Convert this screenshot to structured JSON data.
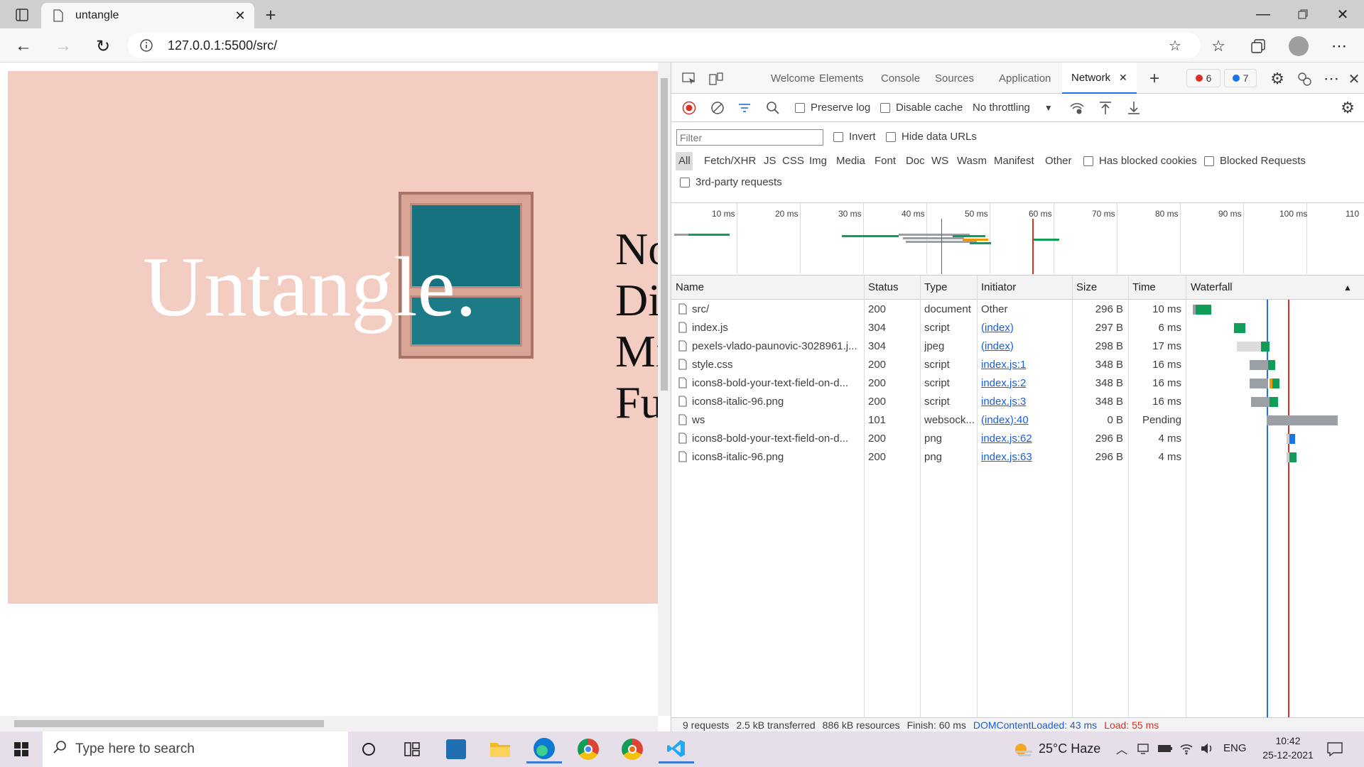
{
  "browser": {
    "tab_title": "untangle",
    "url": "127.0.0.1:5500/src/"
  },
  "page": {
    "hero_title": "Untangle.",
    "side_words": [
      "No",
      "Dis",
      "Mi",
      "Fu"
    ]
  },
  "devtools": {
    "tabs": [
      "Welcome",
      "Elements",
      "Console",
      "Sources",
      "Application",
      "Network"
    ],
    "active_tab": "Network",
    "error_count": "6",
    "message_count": "7",
    "toolbar": {
      "preserve_log": "Preserve log",
      "disable_cache": "Disable cache",
      "throttling": "No throttling"
    },
    "filter": {
      "placeholder": "Filter",
      "invert": "Invert",
      "hide_data_urls": "Hide data URLs",
      "types": [
        "All",
        "Fetch/XHR",
        "JS",
        "CSS",
        "Img",
        "Media",
        "Font",
        "Doc",
        "WS",
        "Wasm",
        "Manifest",
        "Other"
      ],
      "has_blocked_cookies": "Has blocked cookies",
      "blocked_requests": "Blocked Requests",
      "third_party": "3rd-party requests"
    },
    "timeline_ticks": [
      "10 ms",
      "20 ms",
      "30 ms",
      "40 ms",
      "50 ms",
      "60 ms",
      "70 ms",
      "80 ms",
      "90 ms",
      "100 ms",
      "110"
    ],
    "columns": [
      "Name",
      "Status",
      "Type",
      "Initiator",
      "Size",
      "Time",
      "Waterfall"
    ],
    "requests": [
      {
        "name": "src/",
        "status": "200",
        "type": "document",
        "initiator": "Other",
        "size": "296 B",
        "time": "10 ms"
      },
      {
        "name": "index.js",
        "status": "304",
        "type": "script",
        "initiator": "(index)",
        "size": "297 B",
        "time": "6 ms"
      },
      {
        "name": "pexels-vlado-paunovic-3028961.j...",
        "status": "304",
        "type": "jpeg",
        "initiator": "(index)",
        "size": "298 B",
        "time": "17 ms"
      },
      {
        "name": "style.css",
        "status": "200",
        "type": "script",
        "initiator": "index.js:1",
        "size": "348 B",
        "time": "16 ms"
      },
      {
        "name": "icons8-bold-your-text-field-on-d...",
        "status": "200",
        "type": "script",
        "initiator": "index.js:2",
        "size": "348 B",
        "time": "16 ms"
      },
      {
        "name": "icons8-italic-96.png",
        "status": "200",
        "type": "script",
        "initiator": "index.js:3",
        "size": "348 B",
        "time": "16 ms"
      },
      {
        "name": "ws",
        "status": "101",
        "type": "websock...",
        "initiator": "(index):40",
        "size": "0 B",
        "time": "Pending"
      },
      {
        "name": "icons8-bold-your-text-field-on-d...",
        "status": "200",
        "type": "png",
        "initiator": "index.js:62",
        "size": "296 B",
        "time": "4 ms"
      },
      {
        "name": "icons8-italic-96.png",
        "status": "200",
        "type": "png",
        "initiator": "index.js:63",
        "size": "296 B",
        "time": "4 ms"
      }
    ],
    "status": {
      "requests": "9 requests",
      "transferred": "2.5 kB transferred",
      "resources": "886 kB resources",
      "finish": "Finish: 60 ms",
      "dcl": "DOMContentLoaded: 43 ms",
      "load": "Load: 55 ms"
    }
  },
  "taskbar": {
    "search_placeholder": "Type here to search",
    "weather": "25°C  Haze",
    "language": "ENG",
    "time": "10:42",
    "date": "25-12-2021"
  }
}
